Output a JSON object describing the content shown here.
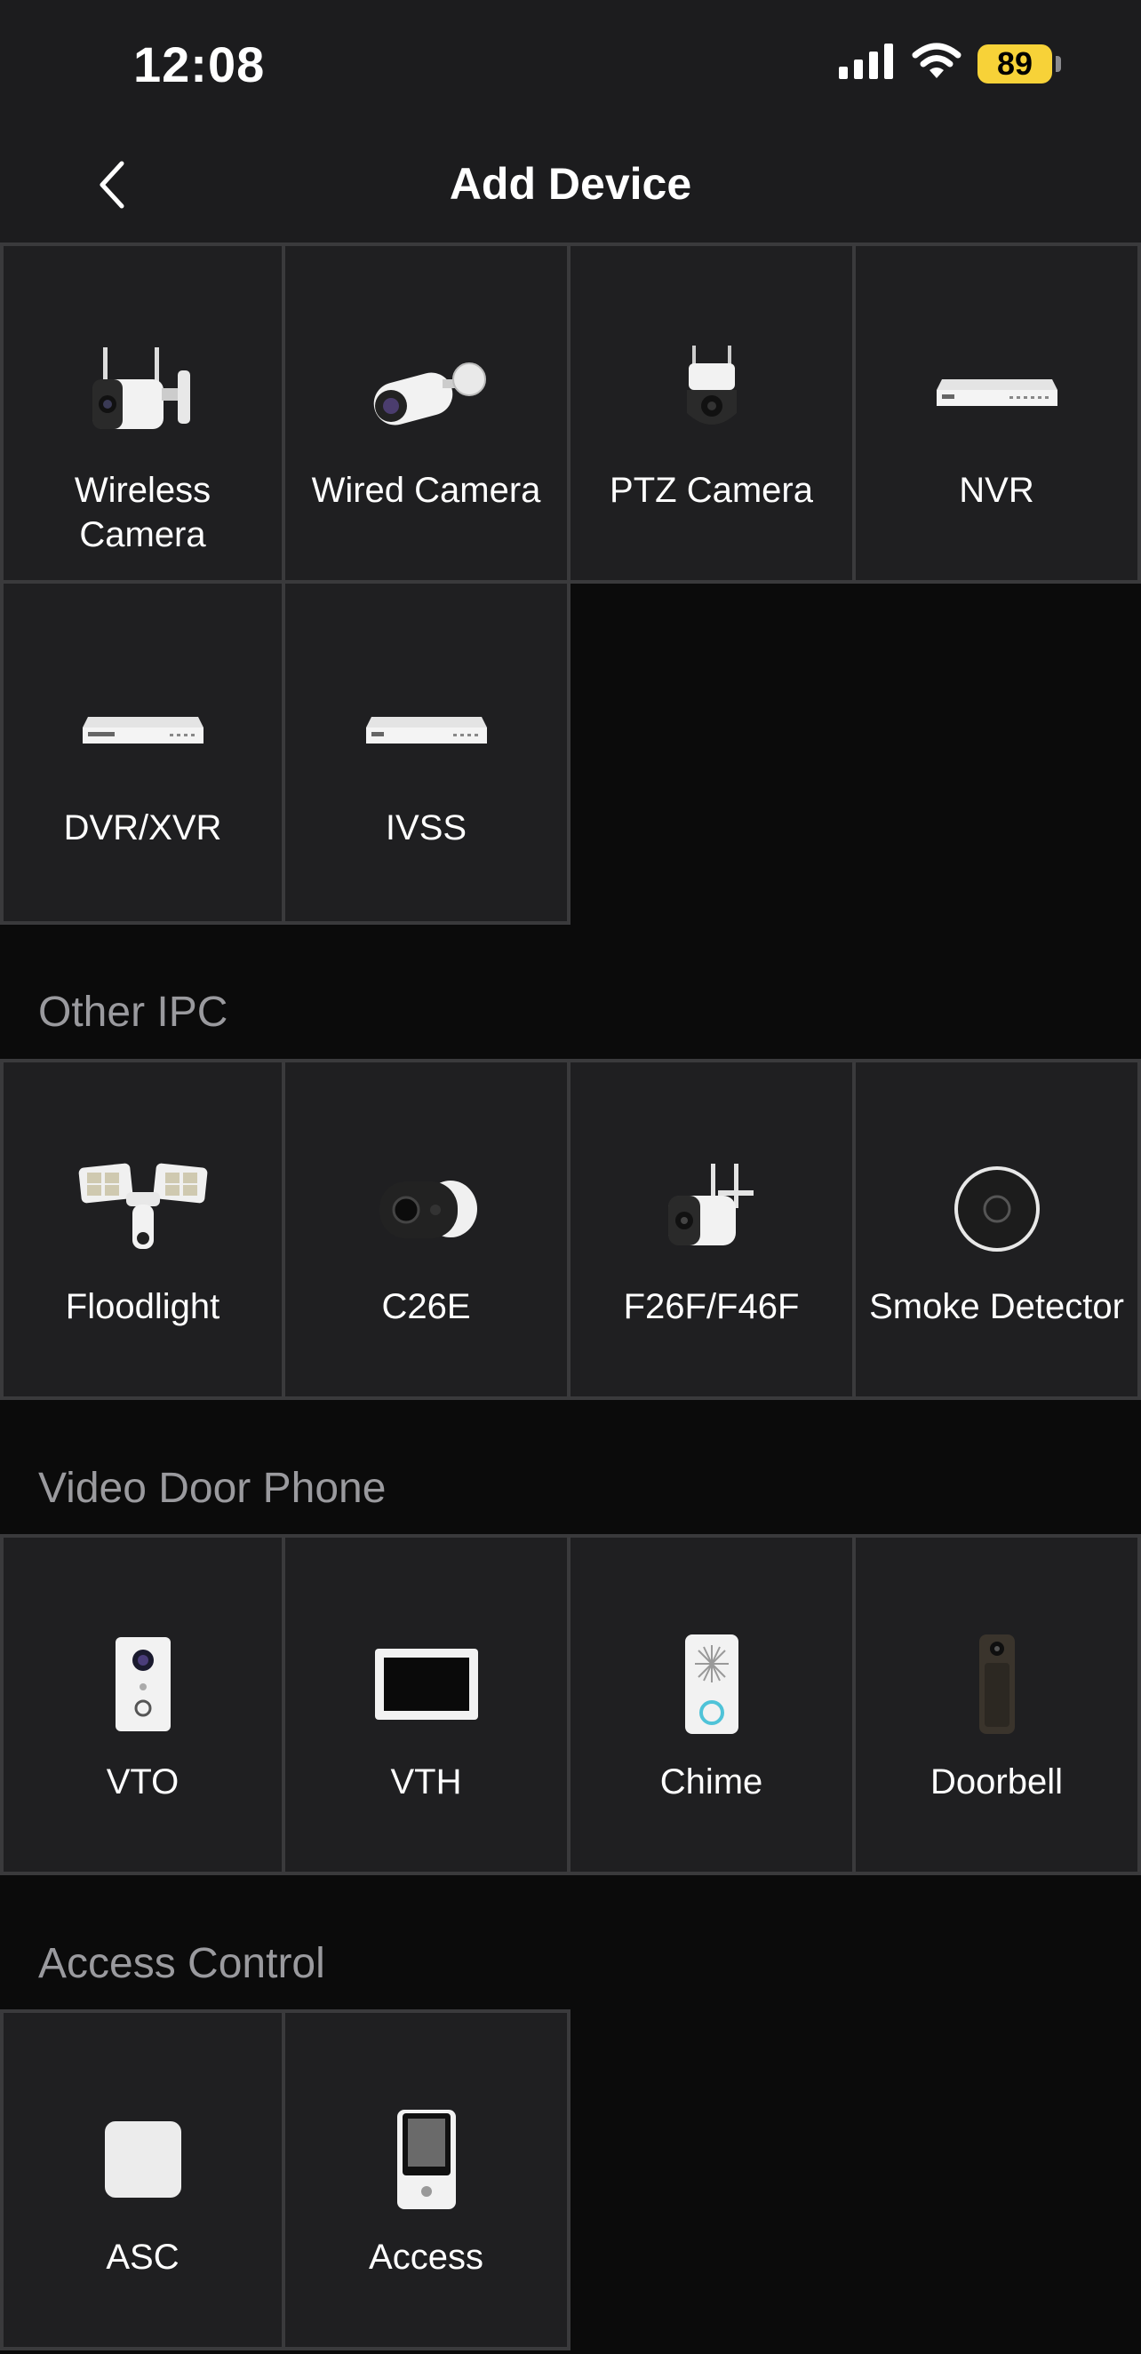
{
  "status_bar": {
    "time": "12:08",
    "battery": "89"
  },
  "nav": {
    "title": "Add Device"
  },
  "devices": [
    {
      "label": "Wireless\nCamera",
      "icon": "wireless-camera-icon"
    },
    {
      "label": "Wired Camera",
      "icon": "wired-camera-icon"
    },
    {
      "label": "PTZ Camera",
      "icon": "ptz-camera-icon"
    },
    {
      "label": "NVR",
      "icon": "nvr-icon"
    },
    {
      "label": "DVR/XVR",
      "icon": "dvr-icon"
    },
    {
      "label": "IVSS",
      "icon": "ivss-icon"
    }
  ],
  "sections": [
    {
      "title": "Other IPC",
      "items": [
        {
          "label": "Floodlight",
          "icon": "floodlight-icon"
        },
        {
          "label": "C26E",
          "icon": "c26e-camera-icon"
        },
        {
          "label": "F26F/F46F",
          "icon": "f26f-camera-icon"
        },
        {
          "label": "Smoke Detector",
          "icon": "smoke-detector-icon"
        }
      ]
    },
    {
      "title": "Video Door Phone",
      "items": [
        {
          "label": "VTO",
          "icon": "vto-icon"
        },
        {
          "label": "VTH",
          "icon": "vth-icon"
        },
        {
          "label": "Chime",
          "icon": "chime-icon"
        },
        {
          "label": "Doorbell",
          "icon": "doorbell-icon"
        }
      ]
    },
    {
      "title": "Access Control",
      "items": [
        {
          "label": "ASC",
          "icon": "asc-icon"
        },
        {
          "label": "Access",
          "icon": "access-icon"
        }
      ]
    }
  ]
}
